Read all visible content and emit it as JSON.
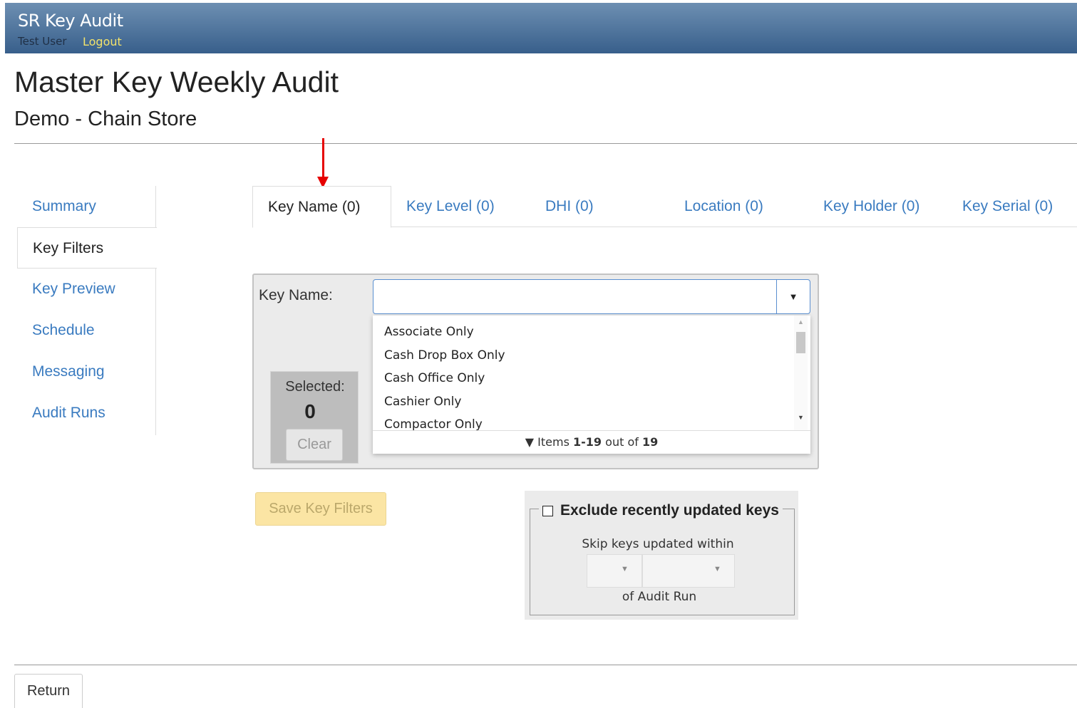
{
  "header": {
    "app_title": "SR Key Audit",
    "user_name": "Test User",
    "logout_label": "Logout"
  },
  "page": {
    "title": "Master Key Weekly Audit",
    "subtitle": "Demo - Chain Store"
  },
  "sidebar": {
    "items": [
      {
        "label": "Summary"
      },
      {
        "label": "Key Filters",
        "active": true
      },
      {
        "label": "Key Preview"
      },
      {
        "label": "Schedule"
      },
      {
        "label": "Messaging"
      },
      {
        "label": "Audit Runs"
      }
    ]
  },
  "tabs": [
    {
      "label": "Key Name (0)",
      "active": true
    },
    {
      "label": "Key Level (0)"
    },
    {
      "label": "DHI (0)"
    },
    {
      "label": "Location (0)"
    },
    {
      "label": "Key Holder (0)"
    },
    {
      "label": "Key Serial (0)"
    }
  ],
  "filter": {
    "label": "Key Name:",
    "input_value": "",
    "options": [
      "Associate Only",
      "Cash Drop Box Only",
      "Cash Office Only",
      "Cashier Only",
      "Compactor Only"
    ],
    "footer": {
      "prefix": "Items",
      "range": "1-19",
      "middle": "out of",
      "total": "19"
    },
    "selected_label": "Selected:",
    "selected_count": "0",
    "clear_label": "Clear"
  },
  "save_label": "Save Key Filters",
  "exclude": {
    "legend": "Exclude recently updated keys",
    "checked": false,
    "skip_label": "Skip keys updated within",
    "of_label": "of Audit Run"
  },
  "return_label": "Return",
  "colors": {
    "link": "#3a7bc0",
    "header_top": "#6d8fb2",
    "header_bottom": "#385f8b",
    "logout": "#f3e36b",
    "annotation_arrow": "#e60000",
    "save_button": "#fbe5a4"
  }
}
